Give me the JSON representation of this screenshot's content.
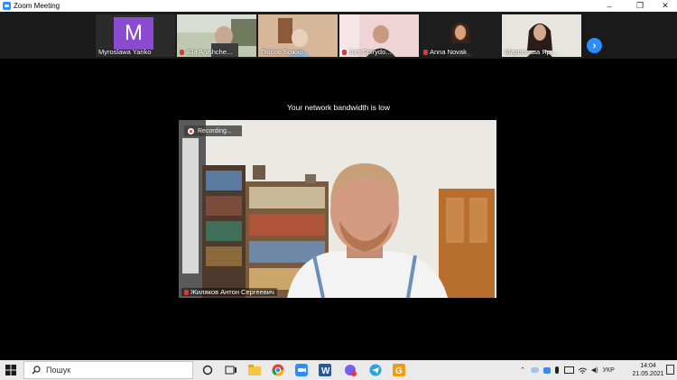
{
  "window": {
    "title": "Zoom Meeting",
    "minimize": "–",
    "restore": "❐",
    "close": "✕"
  },
  "gallery": {
    "tiles": [
      {
        "name": "Myroslawa Yariko",
        "avatar_letter": "M",
        "muted": false
      },
      {
        "name": "Alla Anishche...",
        "muted": true
      },
      {
        "name": "Любов Божко",
        "muted": false
      },
      {
        "name": "Jurij Spirydo...",
        "muted": true
      },
      {
        "name": "Anna Novak",
        "muted": true
      },
      {
        "name": "Мирослава Ярі...",
        "muted": false
      }
    ],
    "next_icon": "›"
  },
  "stage": {
    "network_banner": "Your network bandwidth is low",
    "recording_label": "Recording...",
    "speaker_name": "Жиляков Антон Сергеевич"
  },
  "taskbar": {
    "search_placeholder": "Пошук",
    "language": "УКР",
    "time": "14:04",
    "date": "21.05.2021"
  },
  "colors": {
    "zoom_blue": "#2d8cff",
    "avatar_purple": "#8a4bd1",
    "muted_red": "#d83a3a"
  }
}
